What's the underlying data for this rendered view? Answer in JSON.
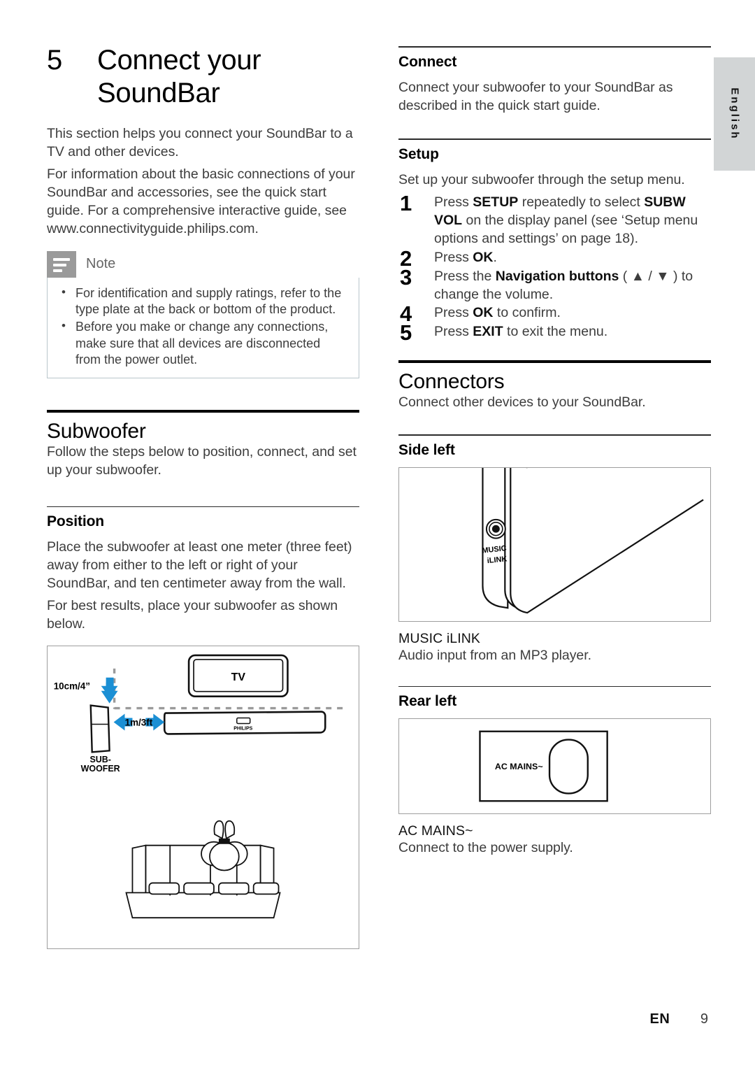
{
  "chapter": {
    "number": "5",
    "title": "Connect your SoundBar",
    "intro": [
      "This section helps you connect your SoundBar to a TV and other devices.",
      "For information about the basic connections of your SoundBar and accessories, see the quick start guide. For a comprehensive interactive guide, see www.connectivityguide.philips.com."
    ]
  },
  "note": {
    "icon": "note-lines-icon",
    "title": "Note",
    "items": [
      "For identification and supply ratings, refer to the type plate at the back or bottom of the product.",
      "Before you make or change any connections, make sure that all devices are disconnected from the power outlet."
    ]
  },
  "subwoofer": {
    "heading": "Subwoofer",
    "intro": "Follow the steps below to position, connect, and set up your subwoofer.",
    "position": {
      "heading": "Position",
      "paragraphs": [
        "Place the subwoofer at least one meter (three feet) away from either to the left or right of your SoundBar, and ten centimeter away from the wall.",
        "For best results, place your subwoofer as shown below."
      ],
      "figure": {
        "tv_label": "TV",
        "brand_label": "PHILIPS",
        "wall_distance_label": "10cm/4”",
        "sub_distance_label": "1m/3ft",
        "subwoofer_label_line1": "SUB-",
        "subwoofer_label_line2": "WOOFER",
        "arrow_color": "#1b8fd4"
      }
    },
    "connect": {
      "heading": "Connect",
      "text": "Connect your subwoofer to your SoundBar as described in the quick start guide."
    },
    "setup": {
      "heading": "Setup",
      "intro": "Set up your subwoofer through the setup menu.",
      "steps": [
        {
          "number": "1",
          "parts": [
            {
              "text": "Press ",
              "bold": false
            },
            {
              "text": "SETUP",
              "bold": true
            },
            {
              "text": " repeatedly to select ",
              "bold": false
            },
            {
              "text": "SUBW VOL",
              "bold": true
            },
            {
              "text": " on the display panel (see ‘Setup menu options and settings’ on page 18).",
              "bold": false
            }
          ]
        },
        {
          "number": "2",
          "parts": [
            {
              "text": "Press ",
              "bold": false
            },
            {
              "text": "OK",
              "bold": true
            },
            {
              "text": ".",
              "bold": false
            }
          ]
        },
        {
          "number": "3",
          "parts": [
            {
              "text": "Press the ",
              "bold": false
            },
            {
              "text": "Navigation buttons",
              "bold": true
            },
            {
              "text": " ( ▲ / ▼ ) to change the volume.",
              "bold": false
            }
          ]
        },
        {
          "number": "4",
          "parts": [
            {
              "text": "Press ",
              "bold": false
            },
            {
              "text": "OK",
              "bold": true
            },
            {
              "text": " to confirm.",
              "bold": false
            }
          ]
        },
        {
          "number": "5",
          "parts": [
            {
              "text": "Press ",
              "bold": false
            },
            {
              "text": "EXIT",
              "bold": true
            },
            {
              "text": " to exit the menu.",
              "bold": false
            }
          ]
        }
      ]
    }
  },
  "connectors": {
    "heading": "Connectors",
    "intro": "Connect other devices to your SoundBar.",
    "side_left": {
      "heading": "Side left",
      "figure": {
        "jack_label_line1": "MUSIC",
        "jack_label_line2": "iLINK"
      },
      "term": "MUSIC iLINK",
      "description": "Audio input from an MP3 player."
    },
    "rear_left": {
      "heading": "Rear left",
      "figure": {
        "socket_label": "AC MAINS~"
      },
      "term": "AC MAINS~",
      "description": "Connect to the power supply."
    }
  },
  "sidebar": {
    "language": "English"
  },
  "footer": {
    "language_code": "EN",
    "page_number": "9"
  }
}
